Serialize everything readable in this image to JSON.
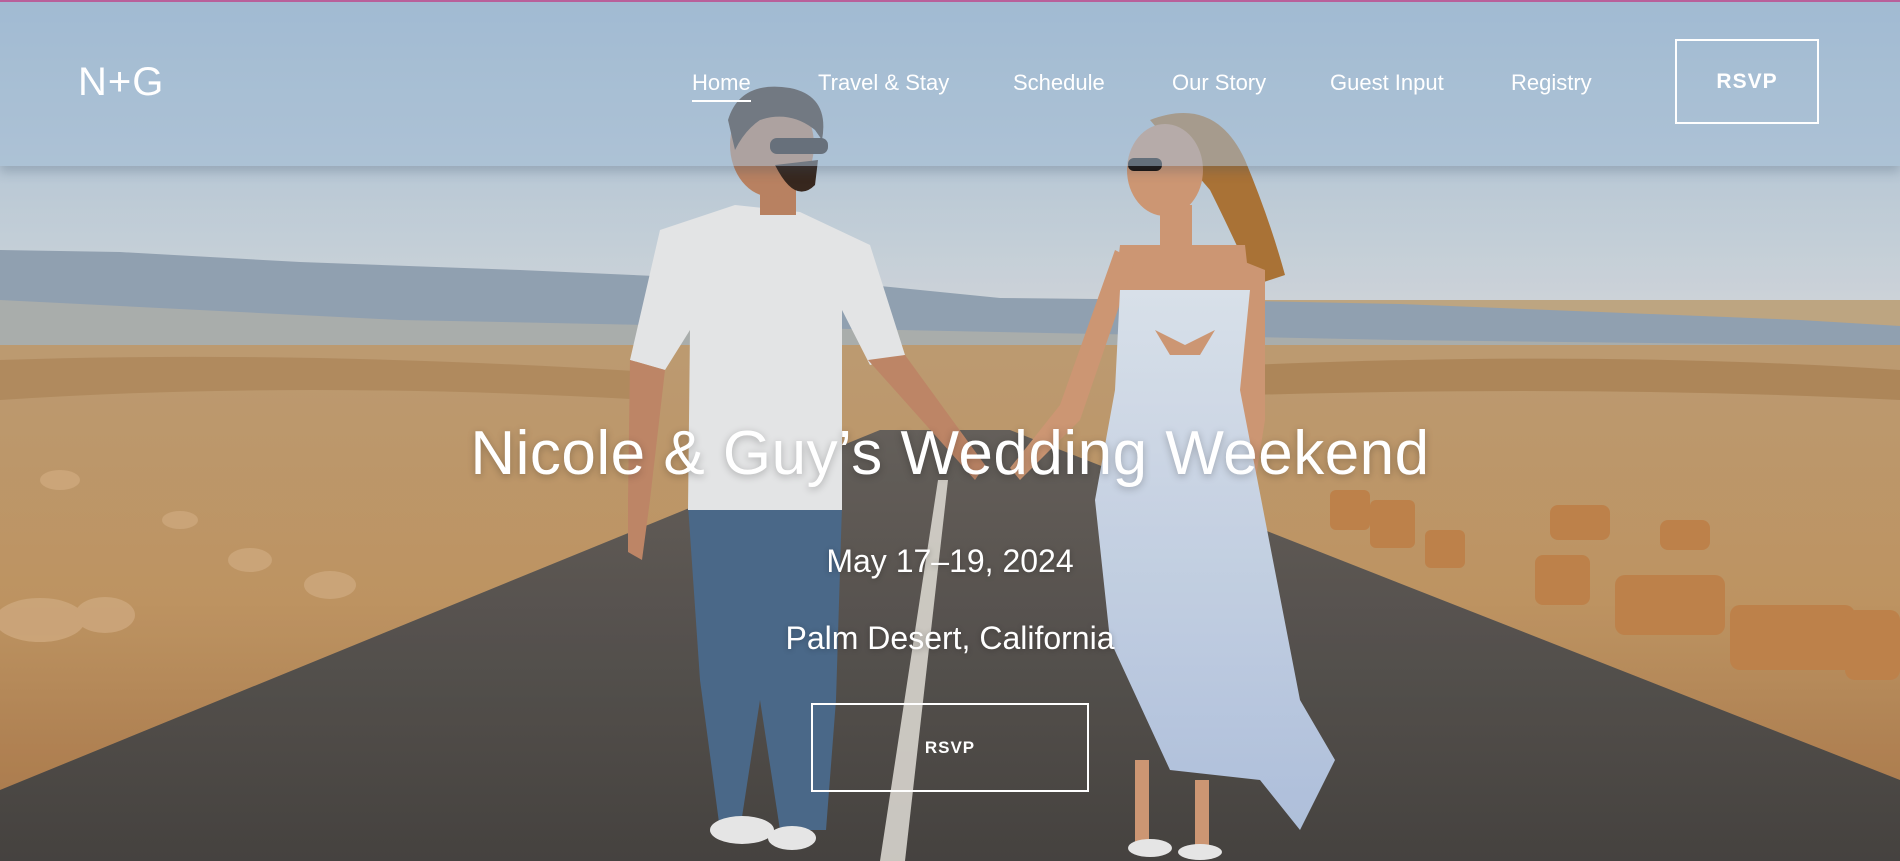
{
  "header": {
    "logo": "N+G",
    "nav": [
      {
        "label": "Home",
        "active": true
      },
      {
        "label": "Travel & Stay",
        "active": false
      },
      {
        "label": "Schedule",
        "active": false
      },
      {
        "label": "Our Story",
        "active": false
      },
      {
        "label": "Guest Input",
        "active": false
      },
      {
        "label": "Registry",
        "active": false
      }
    ],
    "rsvp_label": "RSVP"
  },
  "hero": {
    "title": "Nicole & Guy’s Wedding Weekend",
    "dates": "May 17–19, 2024",
    "location": "Palm Desert, California",
    "rsvp_label": "RSVP",
    "image": "desert-road-couple-photo"
  },
  "colors": {
    "text": "#ffffff",
    "header_tint": "#a4bed6",
    "accent_line": "#b9609a"
  }
}
